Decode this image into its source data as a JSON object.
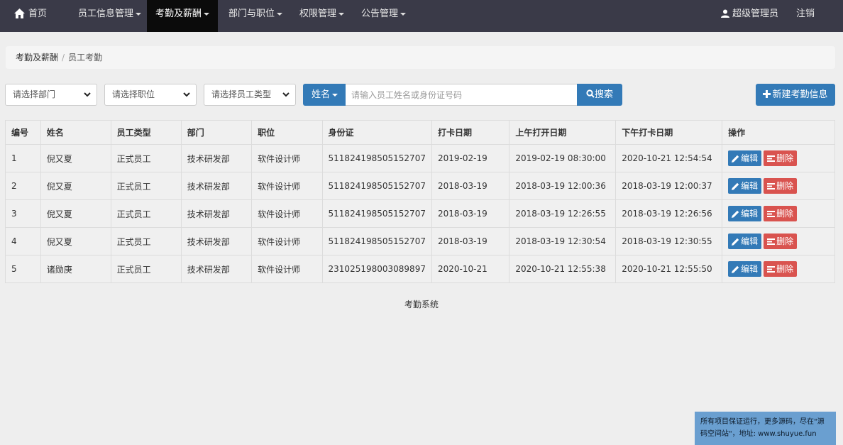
{
  "navbar": {
    "home": "首页",
    "menus": [
      {
        "label": "员工信息管理"
      },
      {
        "label": "考勤及薪酬"
      },
      {
        "label": "部门与职位"
      },
      {
        "label": "权限管理"
      },
      {
        "label": "公告管理"
      }
    ],
    "user": "超级管理员",
    "logout": "注销"
  },
  "breadcrumb": {
    "parent": "考勤及薪酬",
    "current": "员工考勤"
  },
  "filters": {
    "department": "请选择部门",
    "position": "请选择职位",
    "employee_type": "请选择员工类型",
    "search_field": "姓名",
    "search_placeholder": "请输入员工姓名或身份证号码",
    "search_button": "搜索",
    "new_button": "新建考勤信息"
  },
  "table": {
    "headers": [
      "编号",
      "姓名",
      "员工类型",
      "部门",
      "职位",
      "身份证",
      "打卡日期",
      "上午打开日期",
      "下午打卡日期",
      "操作"
    ],
    "rows": [
      [
        "1",
        "倪又夏",
        "正式员工",
        "技术研发部",
        "软件设计师",
        "511824198505152707",
        "2019-02-19",
        "2019-02-19 08:30:00",
        "2020-10-21 12:54:54"
      ],
      [
        "2",
        "倪又夏",
        "正式员工",
        "技术研发部",
        "软件设计师",
        "511824198505152707",
        "2018-03-19",
        "2018-03-19 12:00:36",
        "2018-03-19 12:00:37"
      ],
      [
        "3",
        "倪又夏",
        "正式员工",
        "技术研发部",
        "软件设计师",
        "511824198505152707",
        "2018-03-19",
        "2018-03-19 12:26:55",
        "2018-03-19 12:26:56"
      ],
      [
        "4",
        "倪又夏",
        "正式员工",
        "技术研发部",
        "软件设计师",
        "511824198505152707",
        "2018-03-19",
        "2018-03-19 12:30:54",
        "2018-03-19 12:30:55"
      ],
      [
        "5",
        "诸勋庚",
        "正式员工",
        "技术研发部",
        "软件设计师",
        "231025198003089897",
        "2020-10-21",
        "2020-10-21 12:55:38",
        "2020-10-21 12:55:50"
      ]
    ],
    "edit_label": "编辑",
    "delete_label": "删除"
  },
  "footer": {
    "text": "考勤系统"
  },
  "promo": {
    "text": "所有项目保证运行，更多源码，尽在\"源码空间站\"，地址: www.shuyue.fun"
  },
  "colors": {
    "navbar": "#3a3a48",
    "primary": "#337ab7",
    "danger": "#d9534f"
  }
}
